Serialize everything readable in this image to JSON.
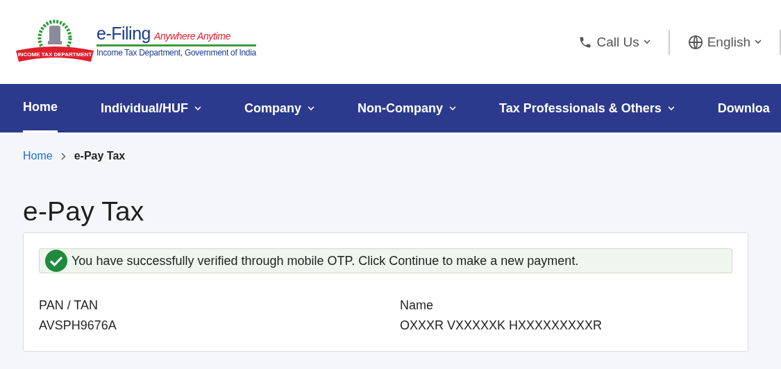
{
  "header": {
    "logo": {
      "title": "e-Filing",
      "tagline": "Anywhere Anytime",
      "subtitle": "Income Tax Department, Government of India",
      "ribbon": "INCOME TAX DEPARTMENT"
    },
    "actions": [
      {
        "kind": "phone",
        "label": "Call Us"
      },
      {
        "kind": "globe",
        "label": "English"
      }
    ]
  },
  "nav": [
    {
      "label": "Home",
      "selected": true,
      "dropdown": false
    },
    {
      "label": "Individual/HUF",
      "selected": false,
      "dropdown": true
    },
    {
      "label": "Company",
      "selected": false,
      "dropdown": true
    },
    {
      "label": "Non-Company",
      "selected": false,
      "dropdown": true
    },
    {
      "label": "Tax Professionals & Others",
      "selected": false,
      "dropdown": true
    },
    {
      "label": "Downloa",
      "selected": false,
      "dropdown": false
    }
  ],
  "breadcrumb": [
    {
      "label": "Home",
      "link": true
    },
    {
      "label": "e-Pay Tax",
      "link": false
    }
  ],
  "page_title": "e-Pay Tax",
  "alert": {
    "message": "You have successfully verified through mobile OTP. Click Continue to make a new payment."
  },
  "fields": [
    {
      "label": "PAN / TAN",
      "value": "AVSPH9676A"
    },
    {
      "label": "Name",
      "value": "OXXXR VXXXXXK HXXXXXXXXXR"
    }
  ]
}
